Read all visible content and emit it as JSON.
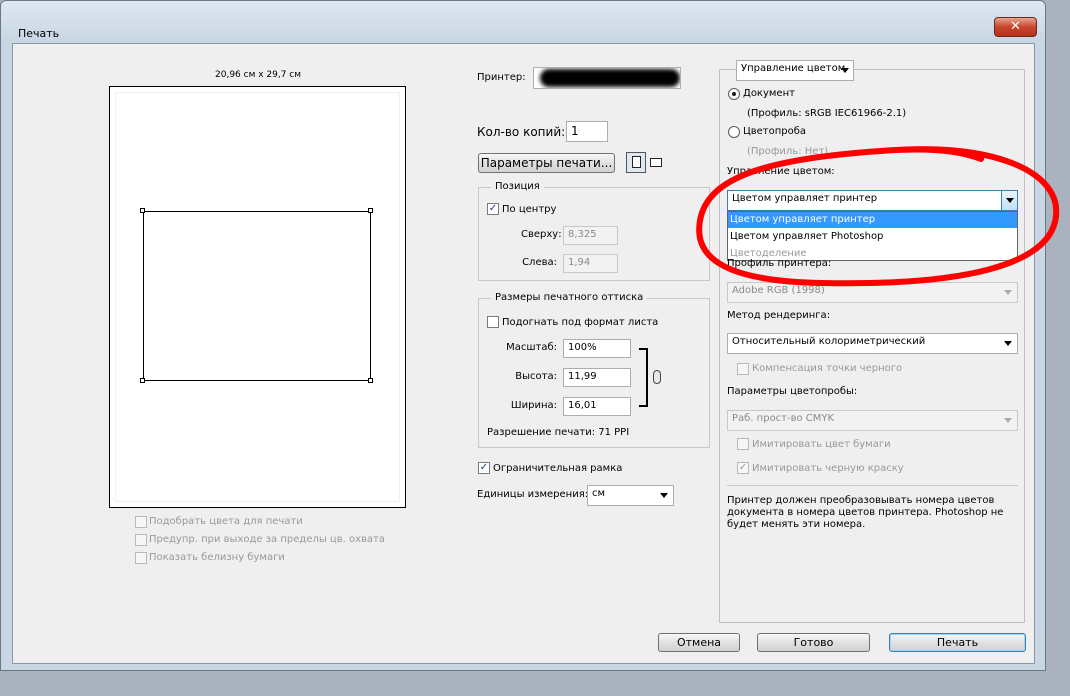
{
  "window": {
    "title": "Печать",
    "close_glyph": "✕"
  },
  "preview": {
    "page_size": "20,96 см x 29,7 см",
    "options": [
      {
        "label": "Подобрать цвета для печати"
      },
      {
        "label": "Предупр. при выходе за пределы цв. охвата"
      },
      {
        "label": "Показать белизну бумаги"
      }
    ]
  },
  "printer": {
    "label": "Принтер:",
    "copies_label": "Кол-во копий:",
    "copies_value": "1",
    "settings_button": "Параметры печати..."
  },
  "position": {
    "legend": "Позиция",
    "center_label": "По центру",
    "center_checked": true,
    "top_label": "Сверху:",
    "top_value": "8,325",
    "left_label": "Слева:",
    "left_value": "1,94"
  },
  "print_size": {
    "legend": "Размеры печатного оттиска",
    "fit_label": "Подогнать под формат листа",
    "scale_label": "Масштаб:",
    "scale_value": "100%",
    "height_label": "Высота:",
    "height_value": "11,99",
    "width_label": "Ширина:",
    "width_value": "16,01",
    "resolution_text": "Разрешение печати: 71 PPI"
  },
  "bounding_box": {
    "label": "Ограничительная рамка",
    "checked": true
  },
  "units": {
    "label": "Единицы измерения:",
    "value": "см"
  },
  "color_panel": {
    "header_dropdown": "Управление цветом",
    "document_label": "Документ",
    "document_profile": "(Профиль: sRGB IEC61966-2.1)",
    "proof_label": "Цветопроба",
    "proof_profile": "(Профиль: Нет)",
    "color_handling_label": "Управление цветом:",
    "color_handling_value": "Цветом управляет принтер",
    "dropdown_options": [
      {
        "label": "Цветом управляет принтер",
        "highlighted": true
      },
      {
        "label": "Цветом управляет Photoshop",
        "highlighted": false
      },
      {
        "label": "Цветоделение",
        "disabled": true
      }
    ],
    "printer_profile_label": "Профиль принтера:",
    "printer_profile_value": "Adobe RGB (1998)",
    "rendering_label": "Метод рендеринга:",
    "rendering_value": "Относительный колориметрический",
    "black_point_label": "Компенсация точки черного",
    "proof_setup_label": "Параметры цветопробы:",
    "proof_setup_value": "Раб. прост-во CMYK",
    "simulate_paper_label": "Имитировать цвет бумаги",
    "simulate_ink_label": "Имитировать черную краску",
    "description": "Принтер должен преобразовывать номера цветов документа в номера цветов принтера. Photoshop не будет менять эти номера."
  },
  "buttons": {
    "cancel": "Отмена",
    "done": "Готово",
    "print": "Печать"
  },
  "colors": {
    "highlight": "#3399ff",
    "annotation_red": "#ff0000",
    "window_bg": "#efefef"
  },
  "icons": [
    "close-icon",
    "link-chain-icon",
    "page-orientation-portrait-icon",
    "page-orientation-landscape-icon"
  ]
}
